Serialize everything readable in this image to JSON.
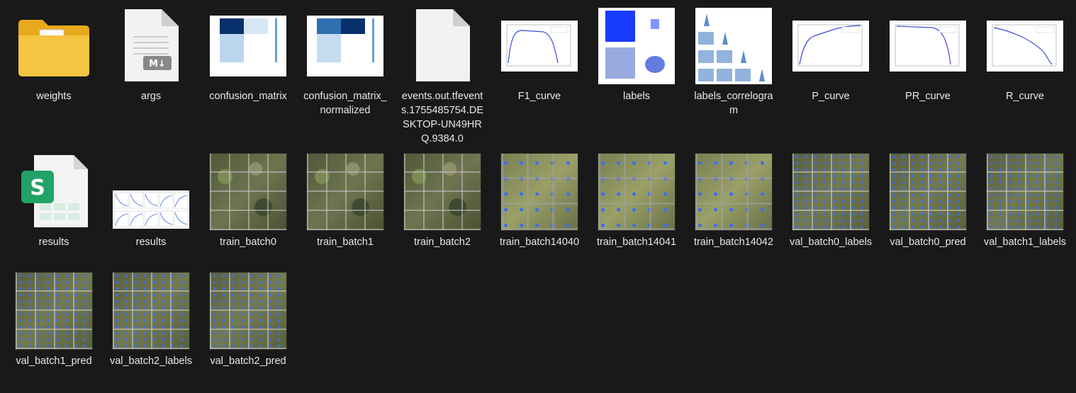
{
  "items": [
    {
      "name": "weights",
      "kind": "folder"
    },
    {
      "name": "args",
      "kind": "markdown"
    },
    {
      "name": "confusion_matrix",
      "kind": "matrix"
    },
    {
      "name": "confusion_matrix_normalized",
      "kind": "matrix_norm"
    },
    {
      "name": "events.out.tfevents.1755485754.DESKTOP-UN49HRQ.9384.0",
      "kind": "blank"
    },
    {
      "name": "F1_curve",
      "kind": "f1"
    },
    {
      "name": "labels",
      "kind": "labels"
    },
    {
      "name": "labels_correlogram",
      "kind": "correlogram"
    },
    {
      "name": "P_curve",
      "kind": "p"
    },
    {
      "name": "PR_curve",
      "kind": "pr"
    },
    {
      "name": "R_curve",
      "kind": "r"
    },
    {
      "name": "results",
      "kind": "sheet"
    },
    {
      "name": "results",
      "kind": "resultsplot"
    },
    {
      "name": "train_batch0",
      "kind": "photo"
    },
    {
      "name": "train_batch1",
      "kind": "photo"
    },
    {
      "name": "train_batch2",
      "kind": "photo"
    },
    {
      "name": "train_batch14040",
      "kind": "train2"
    },
    {
      "name": "train_batch14041",
      "kind": "train2"
    },
    {
      "name": "train_batch14042",
      "kind": "train2"
    },
    {
      "name": "val_batch0_labels",
      "kind": "val"
    },
    {
      "name": "val_batch0_pred",
      "kind": "val"
    },
    {
      "name": "val_batch1_labels",
      "kind": "val"
    },
    {
      "name": "val_batch1_pred",
      "kind": "val"
    },
    {
      "name": "val_batch2_labels",
      "kind": "val"
    },
    {
      "name": "val_batch2_pred",
      "kind": "val"
    }
  ],
  "icons": {
    "sheet_letter": "S",
    "markdown_label": "M↓"
  },
  "colors": {
    "background": "#191919",
    "folder": "#f5c542",
    "sheet_green": "#21a366",
    "matrix_blue": "#08306b"
  }
}
